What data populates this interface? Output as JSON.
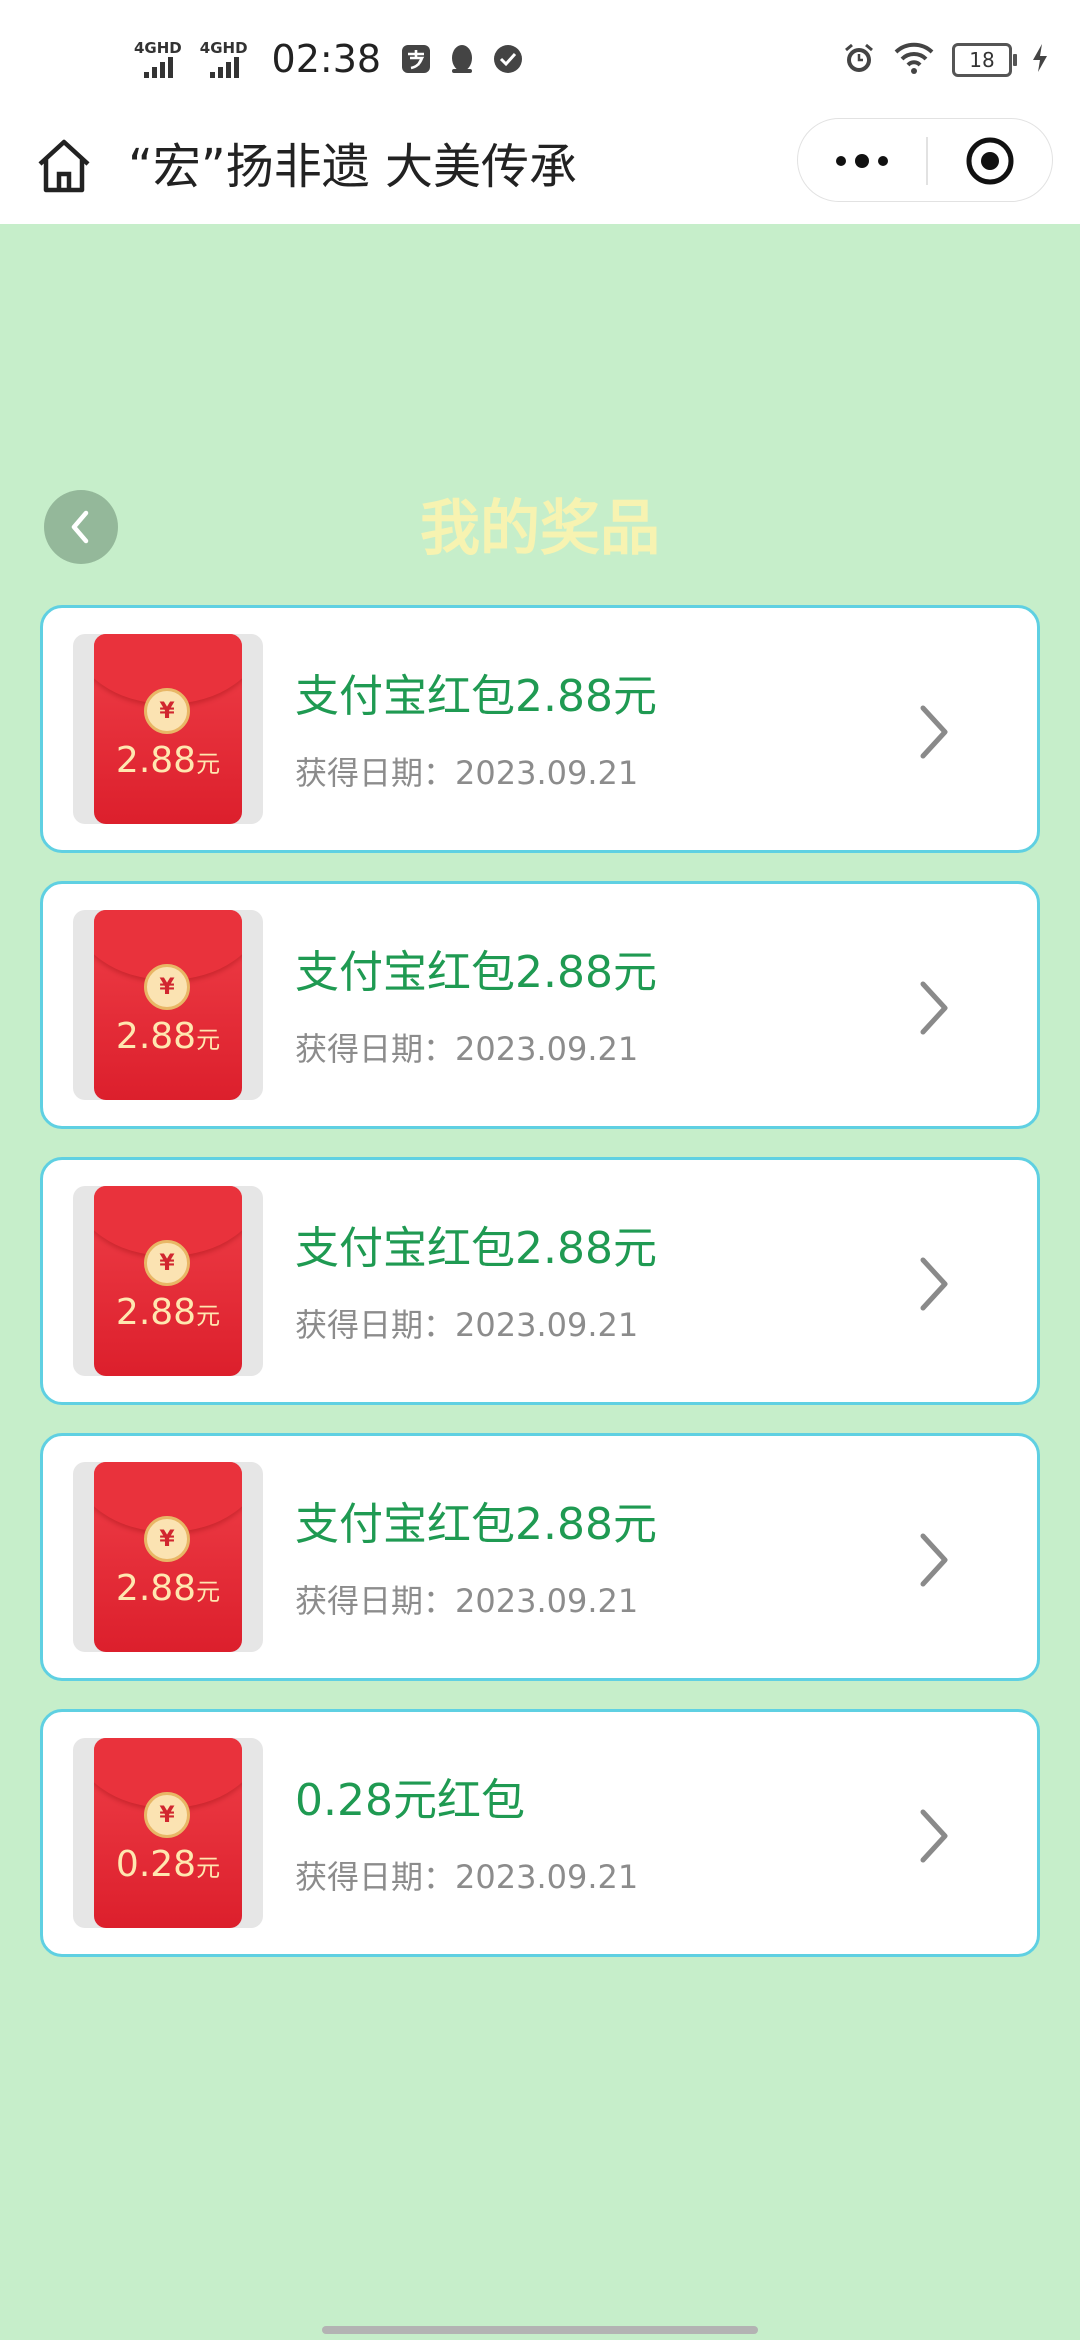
{
  "status_bar": {
    "network1": "4GHD",
    "network2": "4GHD",
    "time": "02:38",
    "battery": "18"
  },
  "title_bar": {
    "title": "“宏”扬非遗 大美传承"
  },
  "heading": "我的奖品",
  "prizes": [
    {
      "name": "支付宝红包2.88元",
      "date": "获得日期：2023.09.21",
      "amount": "2.88",
      "unit": "元"
    },
    {
      "name": "支付宝红包2.88元",
      "date": "获得日期：2023.09.21",
      "amount": "2.88",
      "unit": "元"
    },
    {
      "name": "支付宝红包2.88元",
      "date": "获得日期：2023.09.21",
      "amount": "2.88",
      "unit": "元"
    },
    {
      "name": "支付宝红包2.88元",
      "date": "获得日期：2023.09.21",
      "amount": "2.88",
      "unit": "元"
    },
    {
      "name": "0.28元红包",
      "date": "获得日期：2023.09.21",
      "amount": "0.28",
      "unit": "元"
    }
  ],
  "icons": {
    "coin_symbol": "¥"
  },
  "colors": {
    "background": "#c6eeca",
    "prize_name": "#1f9a52",
    "heading": "#f7f3b1",
    "card_border": "#5fd0e2",
    "envelope": "#e02630"
  }
}
